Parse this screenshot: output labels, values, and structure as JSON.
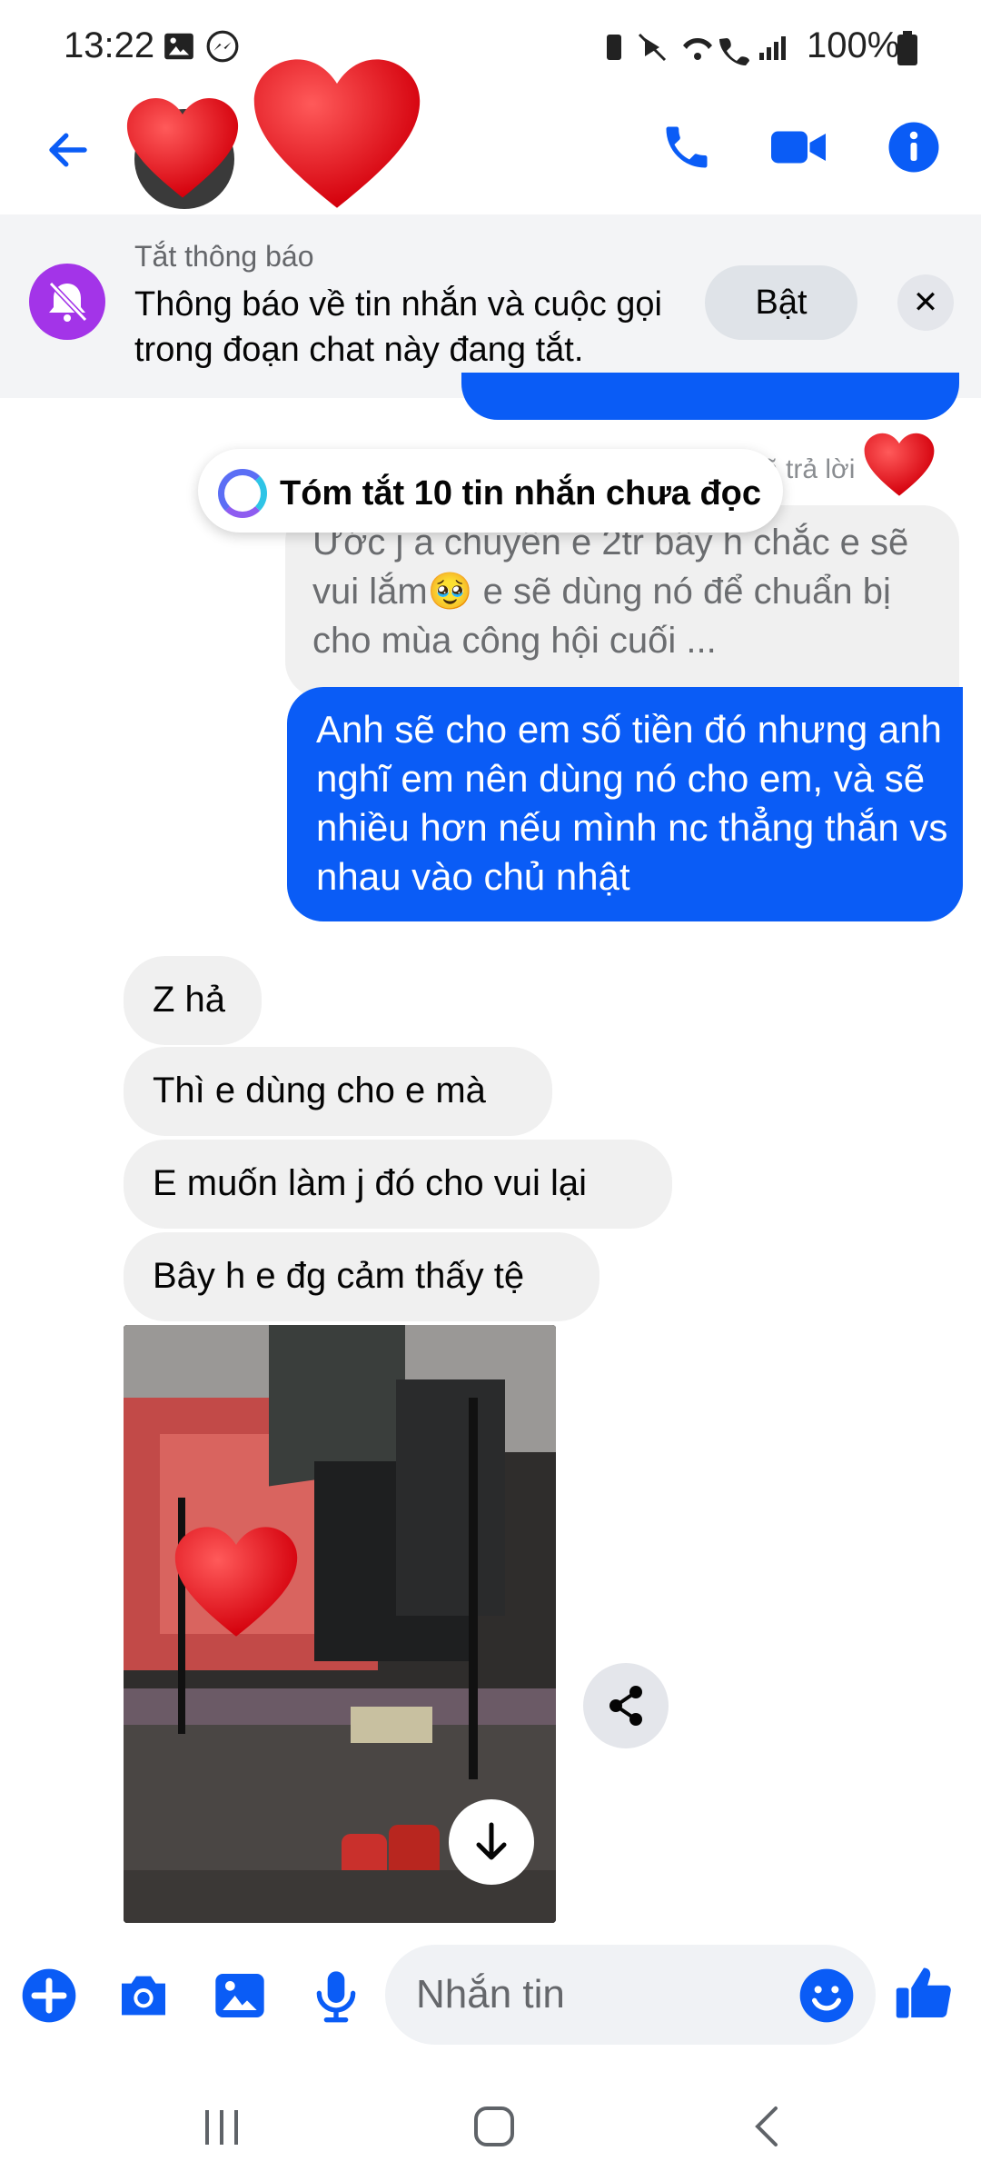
{
  "status_bar": {
    "time": "13:22",
    "battery": "100%"
  },
  "header": {
    "contact_name": ""
  },
  "banner": {
    "title": "Tắt thông báo",
    "body": "Thông báo về tin nhắn và cuộc gọi trong đoạn chat này đang tắt.",
    "enable_label": "Bật",
    "close_label": "✕"
  },
  "thread": {
    "reply_label": "ã trả lời",
    "summary_label": "Tóm tắt 10 tin nhắn chưa đọc",
    "quoted_message": "Ước j a chuyển e 2tr bây h chắc e sẽ vui lắm🥹 e sẽ dùng nó để chuẩn bị cho mùa công hội cuối ...",
    "sent_message": "Anh sẽ cho em số tiền đó nhưng anh nghĩ em nên dùng nó cho em, và sẽ nhiều hơn nếu mình nc thẳng thắn vs nhau vào chủ nhật",
    "received_messages": [
      "Z hả",
      "Thì e dùng cho e mà",
      "E muốn làm j đó cho vui lại",
      "Bây h e đg cảm thấy tệ"
    ]
  },
  "composer": {
    "placeholder": "Nhắn tin"
  },
  "colors": {
    "accent": "#0a5cf6",
    "mute_badge": "#a334e8",
    "heart": "#e0141e"
  }
}
